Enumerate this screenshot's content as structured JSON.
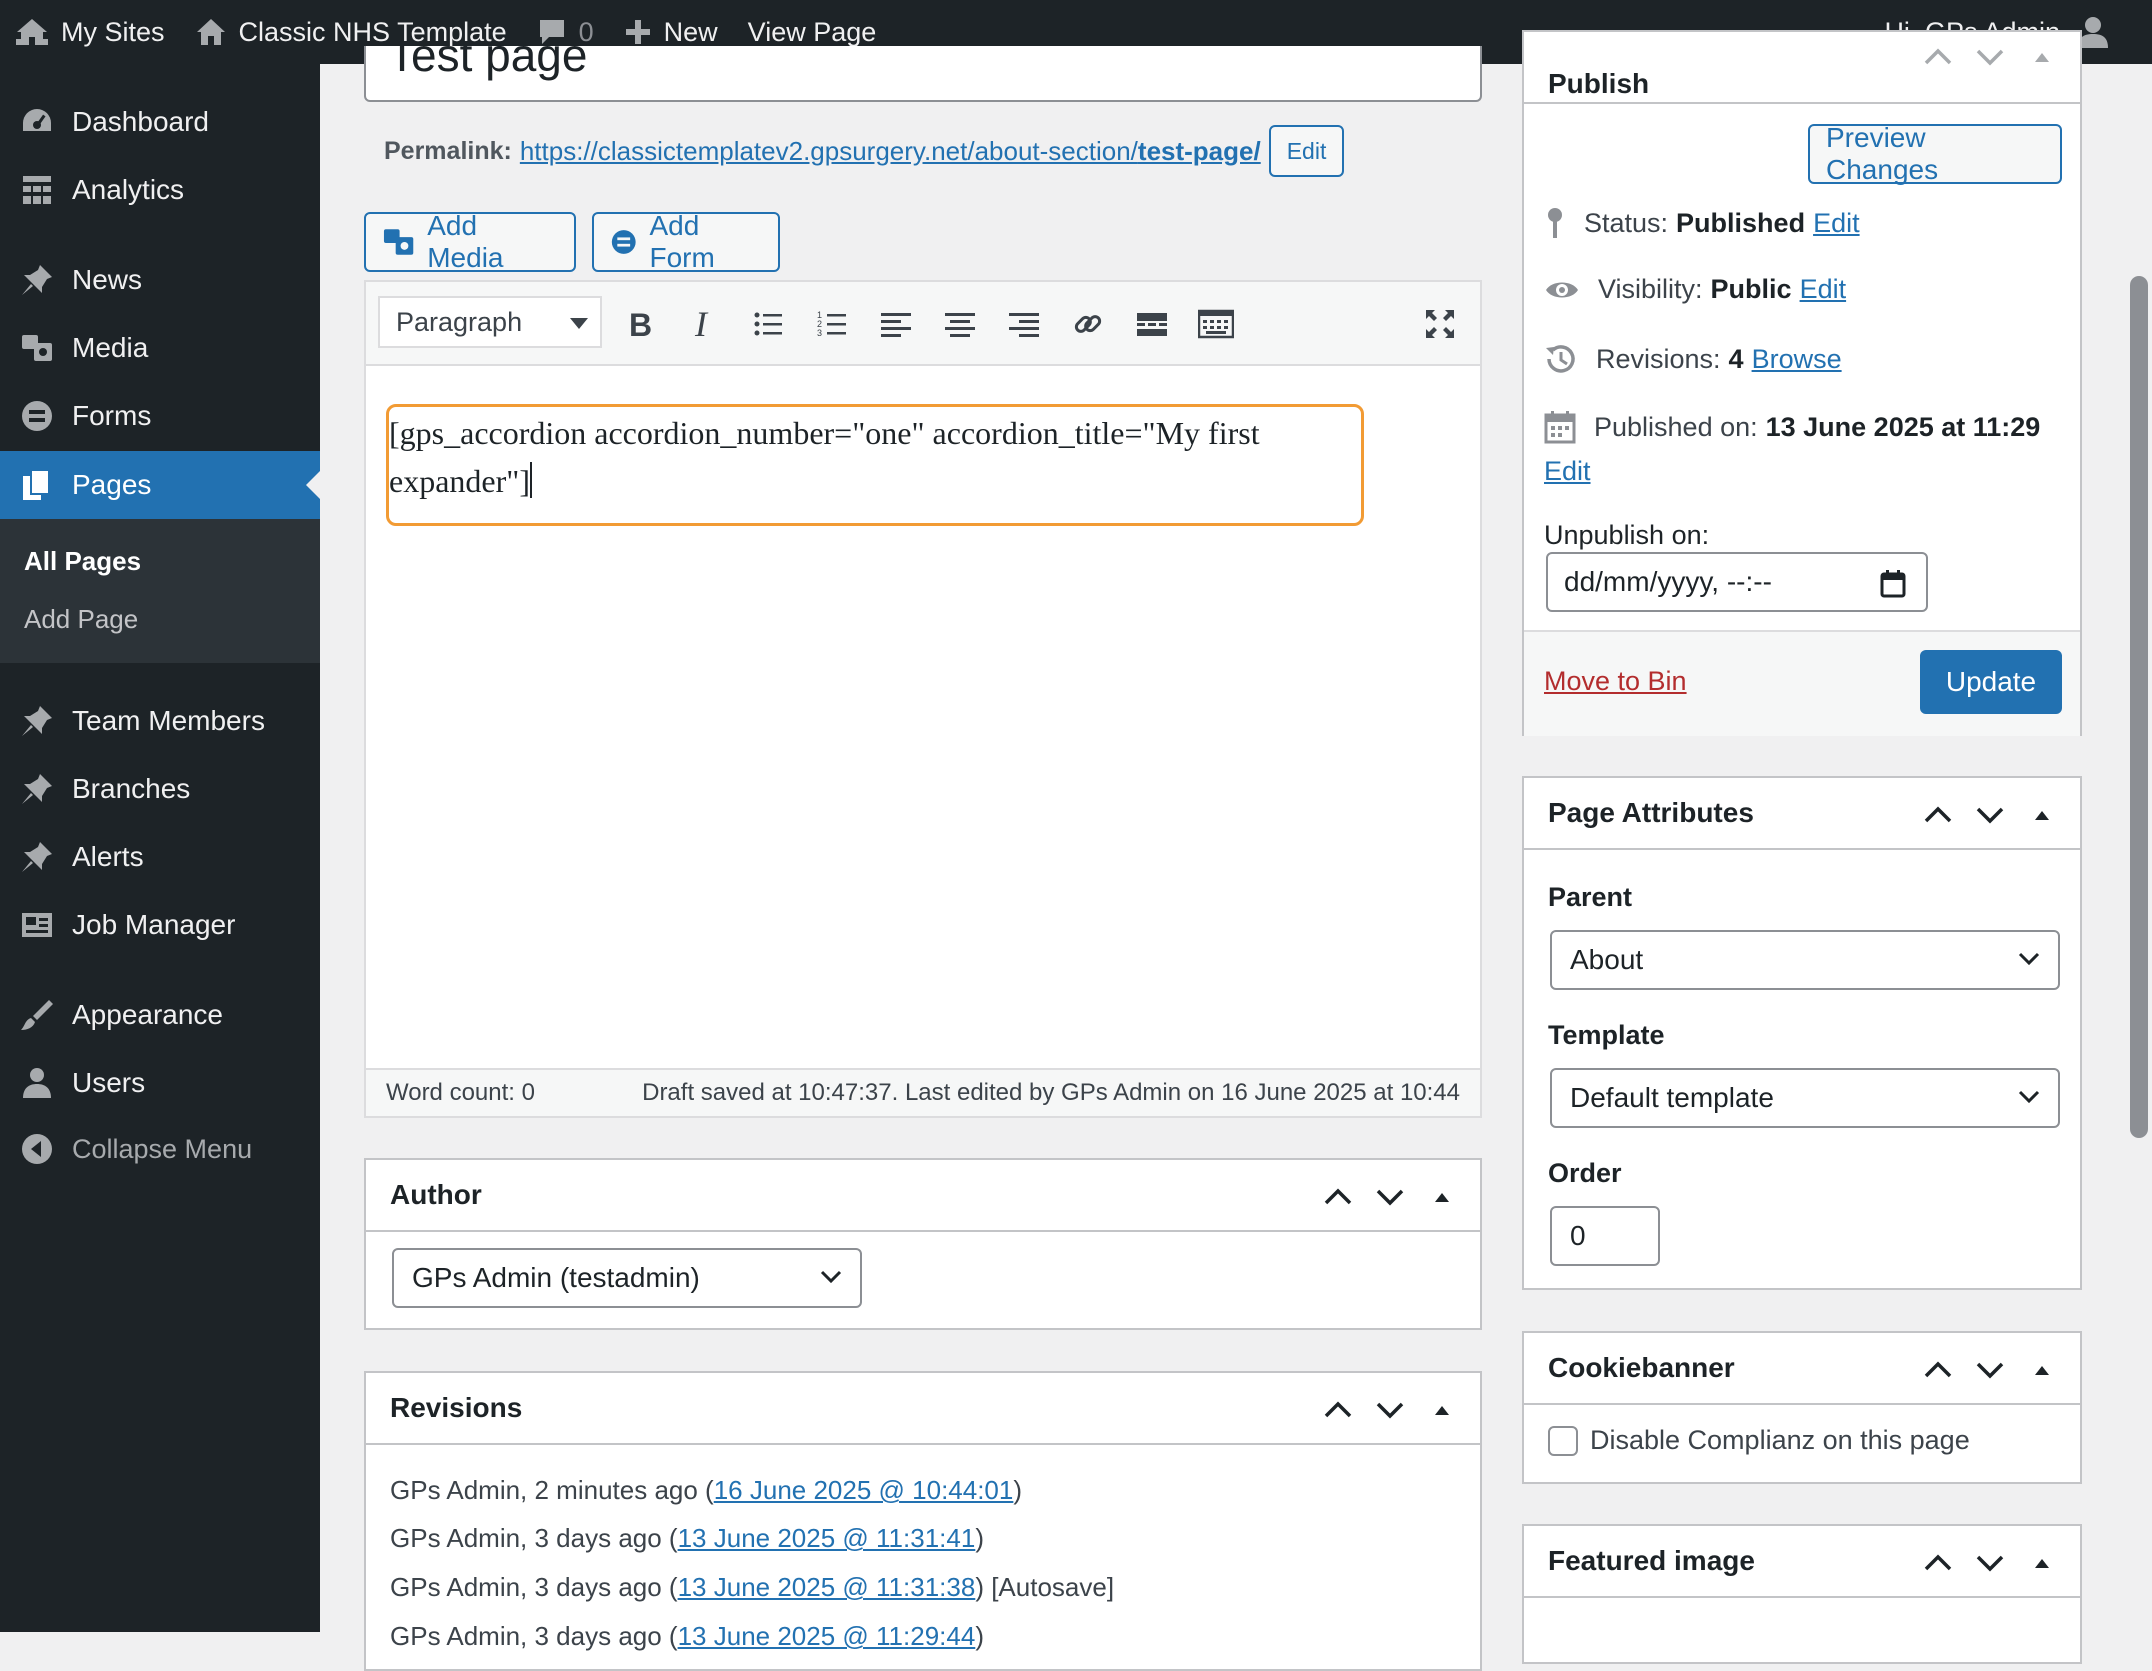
{
  "adminbar": {
    "my_sites": "My Sites",
    "site_name": "Classic NHS Template",
    "comments_count": "0",
    "new": "New",
    "view_page": "View Page",
    "greeting": "Hi, GPs Admin"
  },
  "sidebar": {
    "items": [
      {
        "label": "Dashboard",
        "icon": "dashboard-icon"
      },
      {
        "label": "Analytics",
        "icon": "analytics-icon"
      },
      {
        "label": "News",
        "icon": "pin-icon"
      },
      {
        "label": "Media",
        "icon": "media-icon"
      },
      {
        "label": "Forms",
        "icon": "forms-icon"
      },
      {
        "label": "Pages",
        "icon": "pages-icon"
      },
      {
        "label": "Team Members",
        "icon": "pin-icon"
      },
      {
        "label": "Branches",
        "icon": "pin-icon"
      },
      {
        "label": "Alerts",
        "icon": "pin-icon"
      },
      {
        "label": "Job Manager",
        "icon": "job-icon"
      },
      {
        "label": "Appearance",
        "icon": "appearance-icon"
      },
      {
        "label": "Users",
        "icon": "users-icon"
      },
      {
        "label": "Collapse Menu",
        "icon": "collapse-icon"
      }
    ],
    "submenu": [
      "All Pages",
      "Add Page"
    ]
  },
  "editor": {
    "title": "Test page",
    "permalink_label": "Permalink:",
    "permalink_base": "https://classictemplatev2.gpsurgery.net/about-section/",
    "permalink_slug": "test-page/",
    "permalink_edit": "Edit",
    "add_media": "Add Media",
    "add_form": "Add Form",
    "format": "Paragraph",
    "content_line1": "[gps_accordion accordion_number=\"one\" accordion_title=\"My first",
    "content_line2": "expander\"]",
    "word_count": "Word count: 0",
    "draft_status": "Draft saved at 10:47:37. Last edited by GPs Admin on 16 June 2025 at 10:44"
  },
  "author_box": {
    "title": "Author",
    "selected": "GPs Admin (testadmin)"
  },
  "revisions_box": {
    "title": "Revisions",
    "items": [
      {
        "prefix": "GPs Admin, 2 minutes ago (",
        "link": "16 June 2025 @ 10:44:01",
        "suffix": ")"
      },
      {
        "prefix": "GPs Admin, 3 days ago (",
        "link": "13 June 2025 @ 11:31:41",
        "suffix": ")"
      },
      {
        "prefix": "GPs Admin, 3 days ago (",
        "link": "13 June 2025 @ 11:31:38",
        "suffix": ") [Autosave]"
      },
      {
        "prefix": "GPs Admin, 3 days ago (",
        "link": "13 June 2025 @ 11:29:44",
        "suffix": ")"
      }
    ]
  },
  "publish_box": {
    "title": "Publish",
    "preview": "Preview Changes",
    "status_label": "Status:",
    "status_value": "Published",
    "visibility_label": "Visibility:",
    "visibility_value": "Public",
    "revisions_label": "Revisions:",
    "revisions_value": "4",
    "browse": "Browse",
    "published_label": "Published on:",
    "published_value": "13 June 2025 at 11:29",
    "edit": "Edit",
    "unpublish_label": "Unpublish on:",
    "unpublish_placeholder": "dd/mm/yyyy, --:--",
    "move_to_bin": "Move to Bin",
    "update": "Update"
  },
  "attributes_box": {
    "title": "Page Attributes",
    "parent_label": "Parent",
    "parent_value": "About",
    "template_label": "Template",
    "template_value": "Default template",
    "order_label": "Order",
    "order_value": "0"
  },
  "cookiebanner_box": {
    "title": "Cookiebanner",
    "checkbox_label": "Disable Complianz on this page"
  },
  "featured_box": {
    "title": "Featured image"
  },
  "colors": {
    "accent": "#2271b1",
    "admin_dark": "#1d2327",
    "highlight": "#f29b34",
    "danger": "#b32d2e"
  }
}
